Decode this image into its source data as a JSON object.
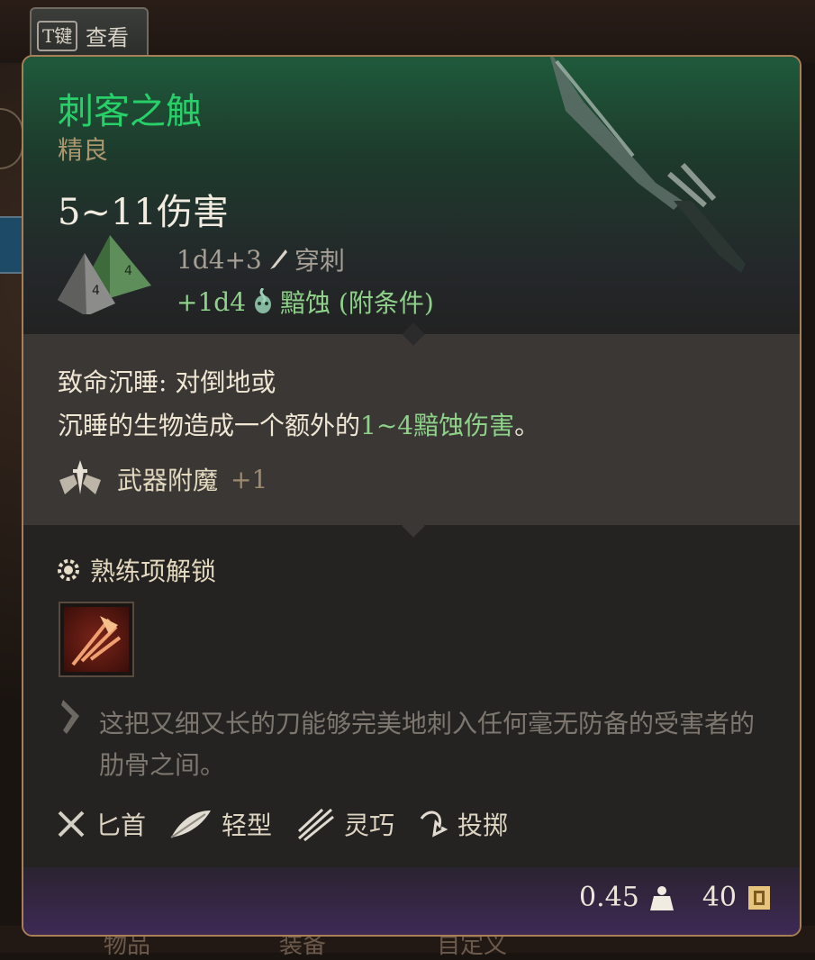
{
  "tab": {
    "key": "T键",
    "label": "查看"
  },
  "item": {
    "name": "刺客之触",
    "rarity": "精良",
    "damage_total": "5~11伤害",
    "damage_lines": [
      {
        "dice": "1d4+3",
        "type": "穿刺",
        "icon": "piercing-icon"
      },
      {
        "dice": "+1d4",
        "type": "黯蚀 (附条件)",
        "icon": "necrotic-skull-icon"
      }
    ]
  },
  "passive": {
    "name": "致命沉睡:",
    "text_a": " 对倒地或",
    "text_b": "沉睡的生物造成一个额外的",
    "highlight": "1~4黯蚀伤害",
    "text_c": "。"
  },
  "enchantment": {
    "label": "武器附魔",
    "value": "+1",
    "icon": "weapon-enchant-icon"
  },
  "proficiency": {
    "label": "熟练项解锁",
    "icon": "proficiency-gear-icon",
    "skill_icon": "piercing-strike-skill-icon"
  },
  "flavor": "这把又细又长的刀能够完美地刺入任何毫无防备的受害者的肋骨之间。",
  "properties": [
    {
      "label": "匕首",
      "icon": "crossed-daggers-icon"
    },
    {
      "label": "轻型",
      "icon": "feather-icon"
    },
    {
      "label": "灵巧",
      "icon": "finesse-icon"
    },
    {
      "label": "投掷",
      "icon": "throw-icon"
    }
  ],
  "footer": {
    "weight": "0.45",
    "weight_icon": "weight-icon",
    "price": "40",
    "price_icon": "gold-coin-icon"
  },
  "background": {
    "bottom_texts": [
      "物品",
      "装备",
      "自定义"
    ]
  },
  "colors": {
    "title": "#27d068",
    "rarity": "#a9966f",
    "highlight": "#8ed28a",
    "border": "#a97f58"
  }
}
